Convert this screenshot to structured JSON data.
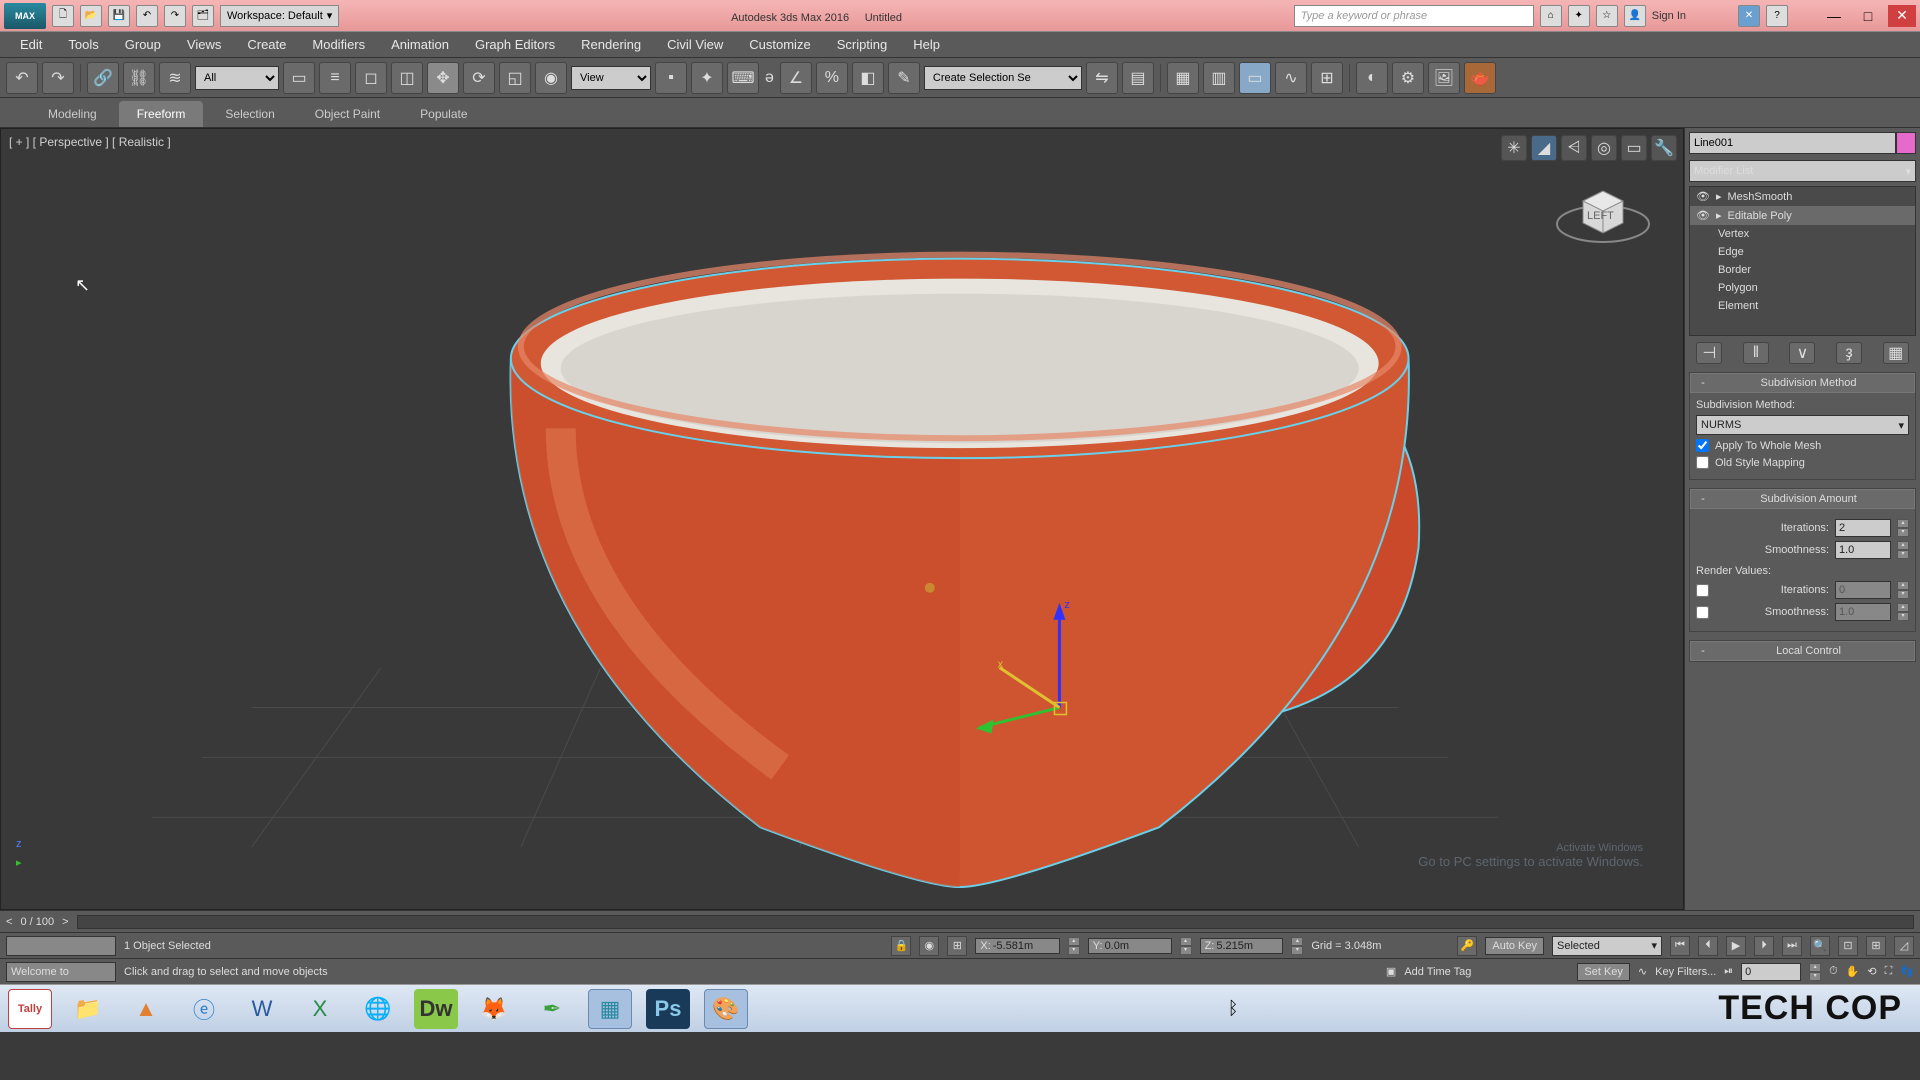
{
  "titlebar": {
    "app_logo": "MAX",
    "workspace_label": "Workspace: Default",
    "app_name": "Autodesk 3ds Max 2016",
    "doc_title": "Untitled",
    "search_placeholder": "Type a keyword or phrase",
    "signin": "Sign In"
  },
  "menu": [
    "Edit",
    "Tools",
    "Group",
    "Views",
    "Create",
    "Modifiers",
    "Animation",
    "Graph Editors",
    "Rendering",
    "Civil View",
    "Customize",
    "Scripting",
    "Help"
  ],
  "toolbar": {
    "filter_all": "All",
    "refcoord": "View",
    "named_sel": "Create Selection Se"
  },
  "ribbon": [
    "Modeling",
    "Freeform",
    "Selection",
    "Object Paint",
    "Populate"
  ],
  "ribbon_active": 1,
  "viewport": {
    "label": "[ + ] [ Perspective ] [ Realistic ]",
    "activate_title": "Activate Windows",
    "activate_sub": "Go to PC settings to activate Windows."
  },
  "panel": {
    "object_name": "Line001",
    "modifier_list_label": "Modifier List",
    "stack": [
      {
        "label": "MeshSmooth",
        "level": 0,
        "sel": false,
        "icons": true
      },
      {
        "label": "Editable Poly",
        "level": 0,
        "sel": true,
        "icons": true
      },
      {
        "label": "Vertex",
        "level": 1,
        "sel": false
      },
      {
        "label": "Edge",
        "level": 1,
        "sel": false
      },
      {
        "label": "Border",
        "level": 1,
        "sel": false
      },
      {
        "label": "Polygon",
        "level": 1,
        "sel": false
      },
      {
        "label": "Element",
        "level": 1,
        "sel": false
      }
    ],
    "rollout_sub_method": "Subdivision Method",
    "sub_method_label": "Subdivision Method:",
    "sub_method_value": "NURMS",
    "apply_whole": "Apply To Whole Mesh",
    "old_style": "Old Style Mapping",
    "rollout_sub_amount": "Subdivision Amount",
    "iterations_label": "Iterations:",
    "iterations_value": "2",
    "smoothness_label": "Smoothness:",
    "smoothness_value": "1.0",
    "render_values_label": "Render Values:",
    "r_iterations_label": "Iterations:",
    "r_iterations_value": "0",
    "r_smoothness_label": "Smoothness:",
    "r_smoothness_value": "1.0",
    "rollout_local": "Local Control"
  },
  "timeline": {
    "frame_display": "0 / 100"
  },
  "status": {
    "selection_info": "1 Object Selected",
    "x_label": "X:",
    "x_val": "-5.581m",
    "y_label": "Y:",
    "y_val": "0.0m",
    "z_label": "Z:",
    "z_val": "5.215m",
    "grid": "Grid = 3.048m",
    "autokey": "Auto Key",
    "setkey": "Set Key",
    "selected_mode": "Selected",
    "keyfilters": "Key Filters...",
    "welcome": "Welcome to",
    "prompt": "Click and drag to select and move objects",
    "addtimetag": "Add Time Tag",
    "frame_current": "0"
  },
  "watermark": "TECH COP"
}
